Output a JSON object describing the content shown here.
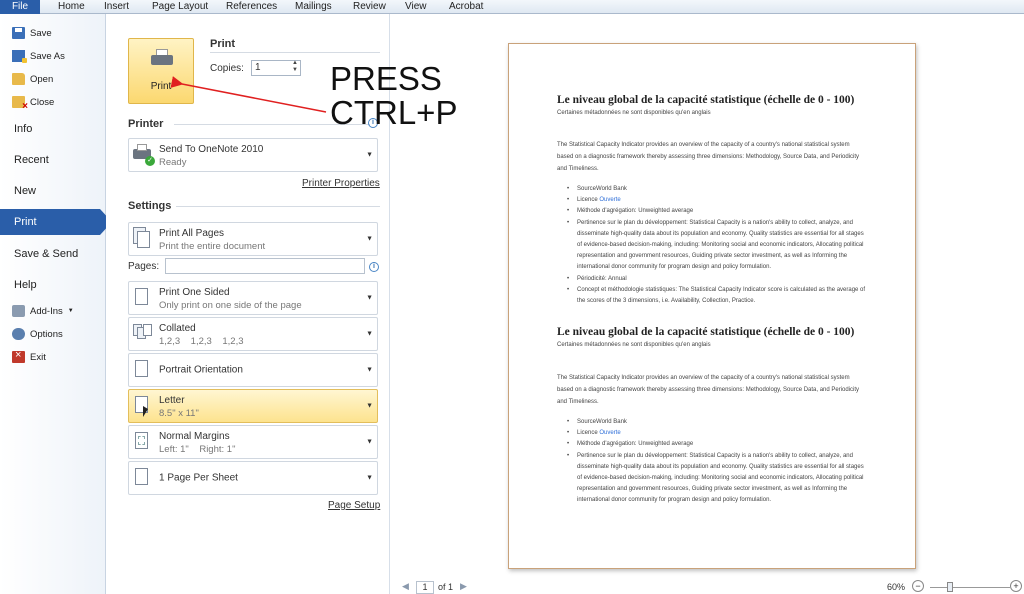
{
  "ribbon": {
    "tabs": [
      "File",
      "Home",
      "Insert",
      "Page Layout",
      "References",
      "Mailings",
      "Review",
      "View",
      "Acrobat"
    ]
  },
  "nav": {
    "save": "Save",
    "save_as": "Save As",
    "open": "Open",
    "close": "Close",
    "info": "Info",
    "recent": "Recent",
    "new": "New",
    "print": "Print",
    "save_send": "Save & Send",
    "help": "Help",
    "add_ins": "Add-Ins",
    "options": "Options",
    "exit": "Exit"
  },
  "print_section": {
    "title": "Print",
    "button_label": "Print",
    "copies_label": "Copies:",
    "copies_value": "1"
  },
  "printer": {
    "title": "Printer",
    "name": "Send To OneNote 2010",
    "status": "Ready",
    "properties_link": "Printer Properties"
  },
  "settings": {
    "title": "Settings",
    "pages_label": "Pages:",
    "items": [
      {
        "main": "Print All Pages",
        "sub": "Print the entire document"
      },
      {
        "main": "Print One Sided",
        "sub": "Only print on one side of the page"
      },
      {
        "main": "Collated",
        "sub": "1,2,3    1,2,3    1,2,3"
      },
      {
        "main": "Portrait Orientation",
        "sub": ""
      },
      {
        "main": "Letter",
        "sub": "8.5\" x 11\""
      },
      {
        "main": "Normal Margins",
        "sub": "Left: 1\"    Right: 1\""
      },
      {
        "main": "1 Page Per Sheet",
        "sub": ""
      }
    ],
    "page_setup_link": "Page Setup"
  },
  "overlay": {
    "line1": "PRESS",
    "line2": "CTRL+P",
    "arrow_color": "#e02020"
  },
  "document": {
    "heading": "Le niveau global de la capacité statistique (échelle de 0 - 100)",
    "subheading": "Certaines métadonnées ne sont disponibles qu'en anglais",
    "intro": "The Statistical Capacity Indicator provides an overview of the capacity of a country's national statistical system based on a diagnostic framework thereby assessing three dimensions: Methodology, Source Data, and Periodicity and Timeliness.",
    "source": "SourceWorld Bank",
    "licence_label": "Licence",
    "licence_link": "Ouverte",
    "method": "Méthode d'agrégation: Unweighted average",
    "pertinence": "Pertinence sur le plan du développement: Statistical Capacity is a nation's ability to collect, analyze, and disseminate high-quality data about its population and economy. Quality statistics are essential for all stages of evidence-based decision-making, including: Monitoring social and economic indicators, Allocating political representation and government resources, Guiding private sector investment, as well as Informing the international donor community for program design and policy formulation.",
    "periodicity": "Périodicité: Annual",
    "concept": "Concept et méthodologie statistiques: The Statistical Capacity Indicator score is calculated as the average of the scores of the 3 dimensions, i.e. Availability, Collection, Practice."
  },
  "status": {
    "page_current": "1",
    "page_total": "of 1",
    "zoom": "60%",
    "zoom_level_percent": 60
  },
  "colors": {
    "accent": "#2a5ea9",
    "highlight": "#fde38e",
    "link": "#2f6fd8"
  }
}
